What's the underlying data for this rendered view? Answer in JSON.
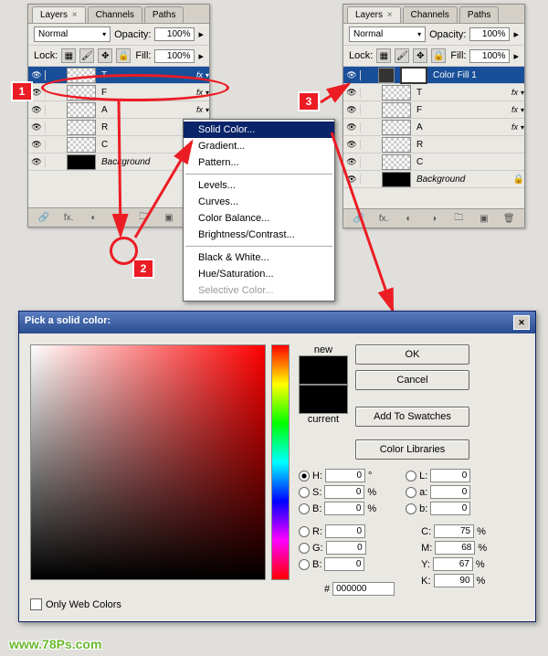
{
  "panelLeft": {
    "tabs": {
      "layers": "Layers",
      "channels": "Channels",
      "paths": "Paths"
    },
    "blend": "Normal",
    "opacityLabel": "Opacity:",
    "opacity": "100%",
    "lockLabel": "Lock:",
    "fillLabel": "Fill:",
    "fill": "100%",
    "layers": [
      {
        "name": "T",
        "sel": true,
        "fx": true,
        "checker": true
      },
      {
        "name": "F",
        "fx": true,
        "checker": true
      },
      {
        "name": "A",
        "fx": true,
        "checker": true
      },
      {
        "name": "R",
        "checker": true
      },
      {
        "name": "C",
        "checker": true
      },
      {
        "name": "Background",
        "black": true,
        "italic": true,
        "lock": true
      }
    ]
  },
  "panelRight": {
    "tabs": {
      "layers": "Layers",
      "channels": "Channels",
      "paths": "Paths"
    },
    "blend": "Normal",
    "opacityLabel": "Opacity:",
    "opacity": "100%",
    "lockLabel": "Lock:",
    "fillLabel": "Fill:",
    "fill": "100%",
    "layers": [
      {
        "name": "Color Fill 1",
        "sel": true,
        "mask": true
      },
      {
        "name": "T",
        "fx": true,
        "checker": true
      },
      {
        "name": "F",
        "fx": true,
        "checker": true
      },
      {
        "name": "A",
        "fx": true,
        "checker": true
      },
      {
        "name": "R",
        "checker": true
      },
      {
        "name": "C",
        "checker": true
      },
      {
        "name": "Background",
        "black": true,
        "italic": true,
        "lock": true
      }
    ]
  },
  "menu": {
    "items": [
      "Solid Color...",
      "Gradient...",
      "Pattern...",
      "Levels...",
      "Curves...",
      "Color Balance...",
      "Brightness/Contrast...",
      "Black & White...",
      "Hue/Saturation...",
      "Selective Color..."
    ],
    "selected": 0,
    "seps": [
      2,
      6
    ]
  },
  "steps": {
    "s1": "1",
    "s2": "2",
    "s3": "3"
  },
  "dialog": {
    "title": "Pick a solid color:",
    "ok": "OK",
    "cancel": "Cancel",
    "addSwatches": "Add To Swatches",
    "colorLibs": "Color Libraries",
    "new": "new",
    "current": "current",
    "onlyWeb": "Only Web Colors",
    "H": {
      "label": "H:",
      "val": "0",
      "unit": "°"
    },
    "S": {
      "label": "S:",
      "val": "0",
      "unit": "%"
    },
    "Bv": {
      "label": "B:",
      "val": "0",
      "unit": "%"
    },
    "R": {
      "label": "R:",
      "val": "0"
    },
    "G": {
      "label": "G:",
      "val": "0"
    },
    "Bb": {
      "label": "B:",
      "val": "0"
    },
    "L": {
      "label": "L:",
      "val": "0"
    },
    "a": {
      "label": "a:",
      "val": "0"
    },
    "b": {
      "label": "b:",
      "val": "0"
    },
    "C": {
      "label": "C:",
      "val": "75",
      "unit": "%"
    },
    "M": {
      "label": "M:",
      "val": "68",
      "unit": "%"
    },
    "Y": {
      "label": "Y:",
      "val": "67",
      "unit": "%"
    },
    "K": {
      "label": "K:",
      "val": "90",
      "unit": "%"
    },
    "hex": {
      "label": "#",
      "val": "000000"
    }
  },
  "watermark": "www.78Ps.com"
}
